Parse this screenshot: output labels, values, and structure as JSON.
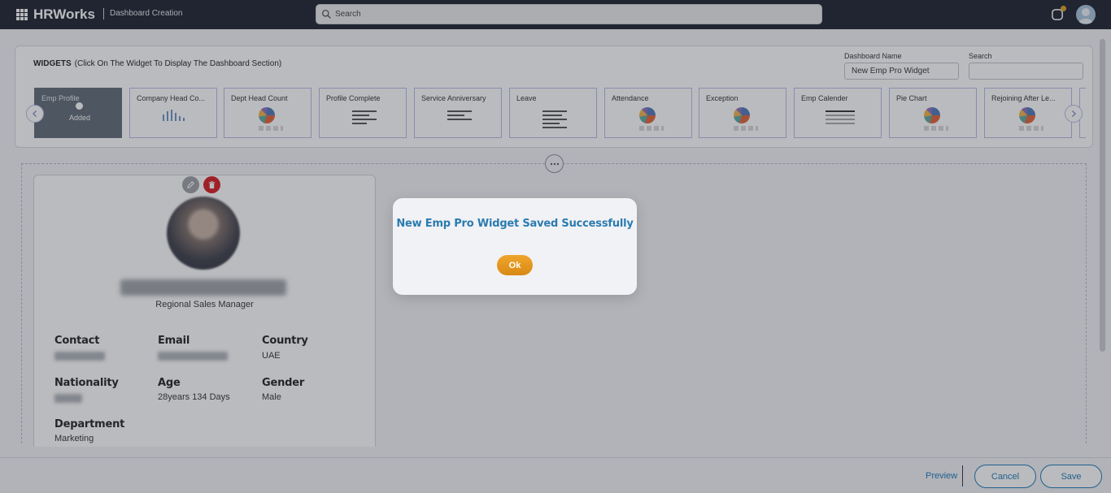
{
  "app": {
    "brand": "HRWorks",
    "module": "Dashboard Creation",
    "search_placeholder": "Search"
  },
  "widgets": {
    "title": "WIDGETS",
    "subtitle": "(Click On The Widget To Display The Dashboard Section)",
    "dashboard_name_label": "Dashboard Name",
    "dashboard_name_value": "New Emp Pro Widget",
    "search_label": "Search",
    "added_label": "Added",
    "items": [
      {
        "label": "Emp Profile",
        "preview": "added"
      },
      {
        "label": "Company Head Co...",
        "preview": "bars"
      },
      {
        "label": "Dept Head Count",
        "preview": "pie"
      },
      {
        "label": "Profile Complete",
        "preview": "list"
      },
      {
        "label": "Service Anniversary",
        "preview": "list"
      },
      {
        "label": "Leave",
        "preview": "list"
      },
      {
        "label": "Attendance",
        "preview": "pie"
      },
      {
        "label": "Exception",
        "preview": "pie"
      },
      {
        "label": "Emp Calender",
        "preview": "calendar"
      },
      {
        "label": "Pie Chart",
        "preview": "pie"
      },
      {
        "label": "Rejoining After Le...",
        "preview": "pie"
      }
    ]
  },
  "profile": {
    "role": "Regional Sales Manager",
    "fields": {
      "contact_label": "Contact",
      "email_label": "Email",
      "country_label": "Country",
      "country_value": "UAE",
      "nationality_label": "Nationality",
      "age_label": "Age",
      "age_value": "28years 134 Days",
      "gender_label": "Gender",
      "gender_value": "Male",
      "department_label": "Department",
      "department_value": "Marketing"
    }
  },
  "footer": {
    "preview": "Preview",
    "cancel": "Cancel",
    "save": "Save"
  },
  "modal": {
    "message": "New Emp Pro Widget Saved Successfully",
    "ok": "Ok"
  },
  "colors": {
    "topbar": "#1e2330",
    "accent": "#1d7ab8",
    "ok_button": "#e3951f",
    "delete": "#d81c23"
  }
}
